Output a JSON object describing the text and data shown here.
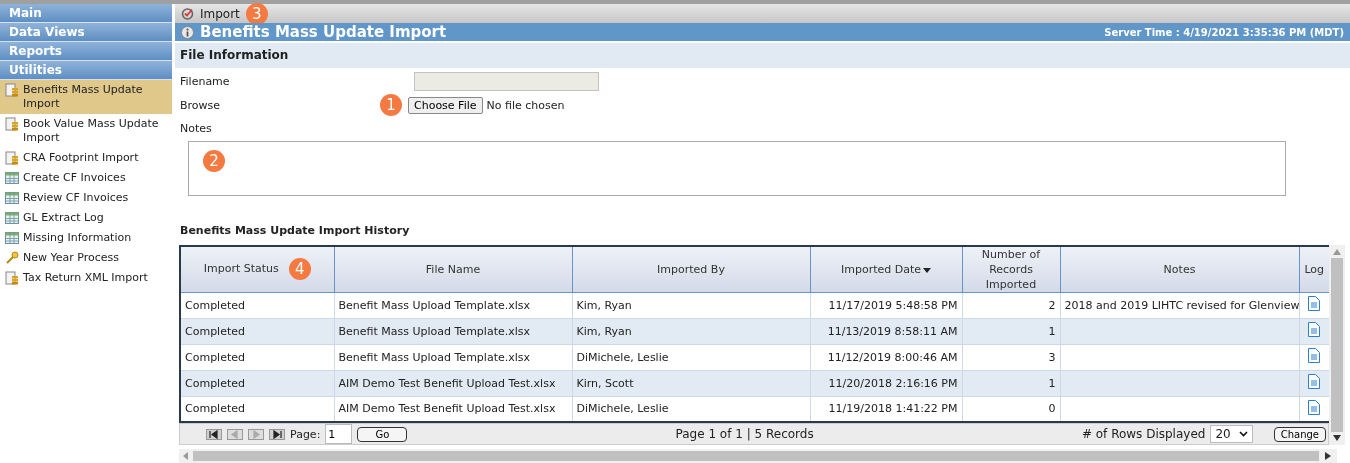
{
  "sidebar": {
    "sections": [
      {
        "label": "Main"
      },
      {
        "label": "Data Views"
      },
      {
        "label": "Reports"
      },
      {
        "label": "Utilities"
      }
    ],
    "items": [
      {
        "label": "Benefits Mass Update Import",
        "kind": "import",
        "selected": true
      },
      {
        "label": "Book Value Mass Update Import",
        "kind": "import",
        "selected": false
      },
      {
        "label": "CRA Footprint Import",
        "kind": "import",
        "selected": false
      },
      {
        "label": "Create CF Invoices",
        "kind": "grid",
        "selected": false
      },
      {
        "label": "Review CF Invoices",
        "kind": "grid",
        "selected": false
      },
      {
        "label": "GL Extract Log",
        "kind": "grid",
        "selected": false
      },
      {
        "label": "Missing Information",
        "kind": "grid",
        "selected": false
      },
      {
        "label": "New Year Process",
        "kind": "key",
        "selected": false
      },
      {
        "label": "Tax Return XML Import",
        "kind": "import",
        "selected": false
      }
    ]
  },
  "toolbar": {
    "label": "Import",
    "callout": "3"
  },
  "title_bar": {
    "title": "Benefits Mass Update Import",
    "server_time": "Server Time : 4/19/2021 3:35:36 PM (MDT)"
  },
  "file_information": {
    "heading": "File Information",
    "filename_label": "Filename",
    "browse_label": "Browse",
    "browse_callout": "1",
    "choose_button": "Choose File",
    "no_file": "No file chosen",
    "notes_label": "Notes",
    "notes_callout": "2"
  },
  "history": {
    "heading": "Benefits Mass Update Import History",
    "columns": [
      {
        "label": "Import Status",
        "callout": "4",
        "sorted": false
      },
      {
        "label": "File Name",
        "sorted": false
      },
      {
        "label": "Imported By",
        "sorted": false
      },
      {
        "label": "Imported Date",
        "sorted": true
      },
      {
        "label": "Number of Records Imported",
        "sorted": false
      },
      {
        "label": "Notes",
        "sorted": false
      },
      {
        "label": "Log",
        "sorted": false
      }
    ],
    "rows": [
      {
        "status": "Completed",
        "file": "Benefit Mass Upload Template.xlsx",
        "by": "Kim, Ryan",
        "date": "11/17/2019 5:48:58 PM",
        "count": "2",
        "notes": "2018 and 2019 LIHTC revised for Glenview"
      },
      {
        "status": "Completed",
        "file": "Benefit Mass Upload Template.xlsx",
        "by": "Kim, Ryan",
        "date": "11/13/2019 8:58:11 AM",
        "count": "1"
      },
      {
        "status": "Completed",
        "file": "Benefit Mass Upload Template.xlsx",
        "by": "DiMichele, Leslie",
        "date": "11/12/2019 8:00:46 AM",
        "count": "3"
      },
      {
        "status": "Completed",
        "file": "AIM Demo Test Benefit Upload Test.xlsx",
        "by": "Kirn, Scott",
        "date": "11/20/2018 2:16:16 PM",
        "count": "1"
      },
      {
        "status": "Completed",
        "file": "AIM Demo Test Benefit Upload Test.xlsx",
        "by": "DiMichele, Leslie",
        "date": "11/19/2018 1:41:22 PM",
        "count": "0"
      }
    ],
    "pager": {
      "page_label": "Page:",
      "page_value": "1",
      "go": "Go",
      "summary": "Page 1 of 1 | 5 Records",
      "rows_label": "# of Rows Displayed",
      "rows_value": "20",
      "change": "Change"
    }
  }
}
